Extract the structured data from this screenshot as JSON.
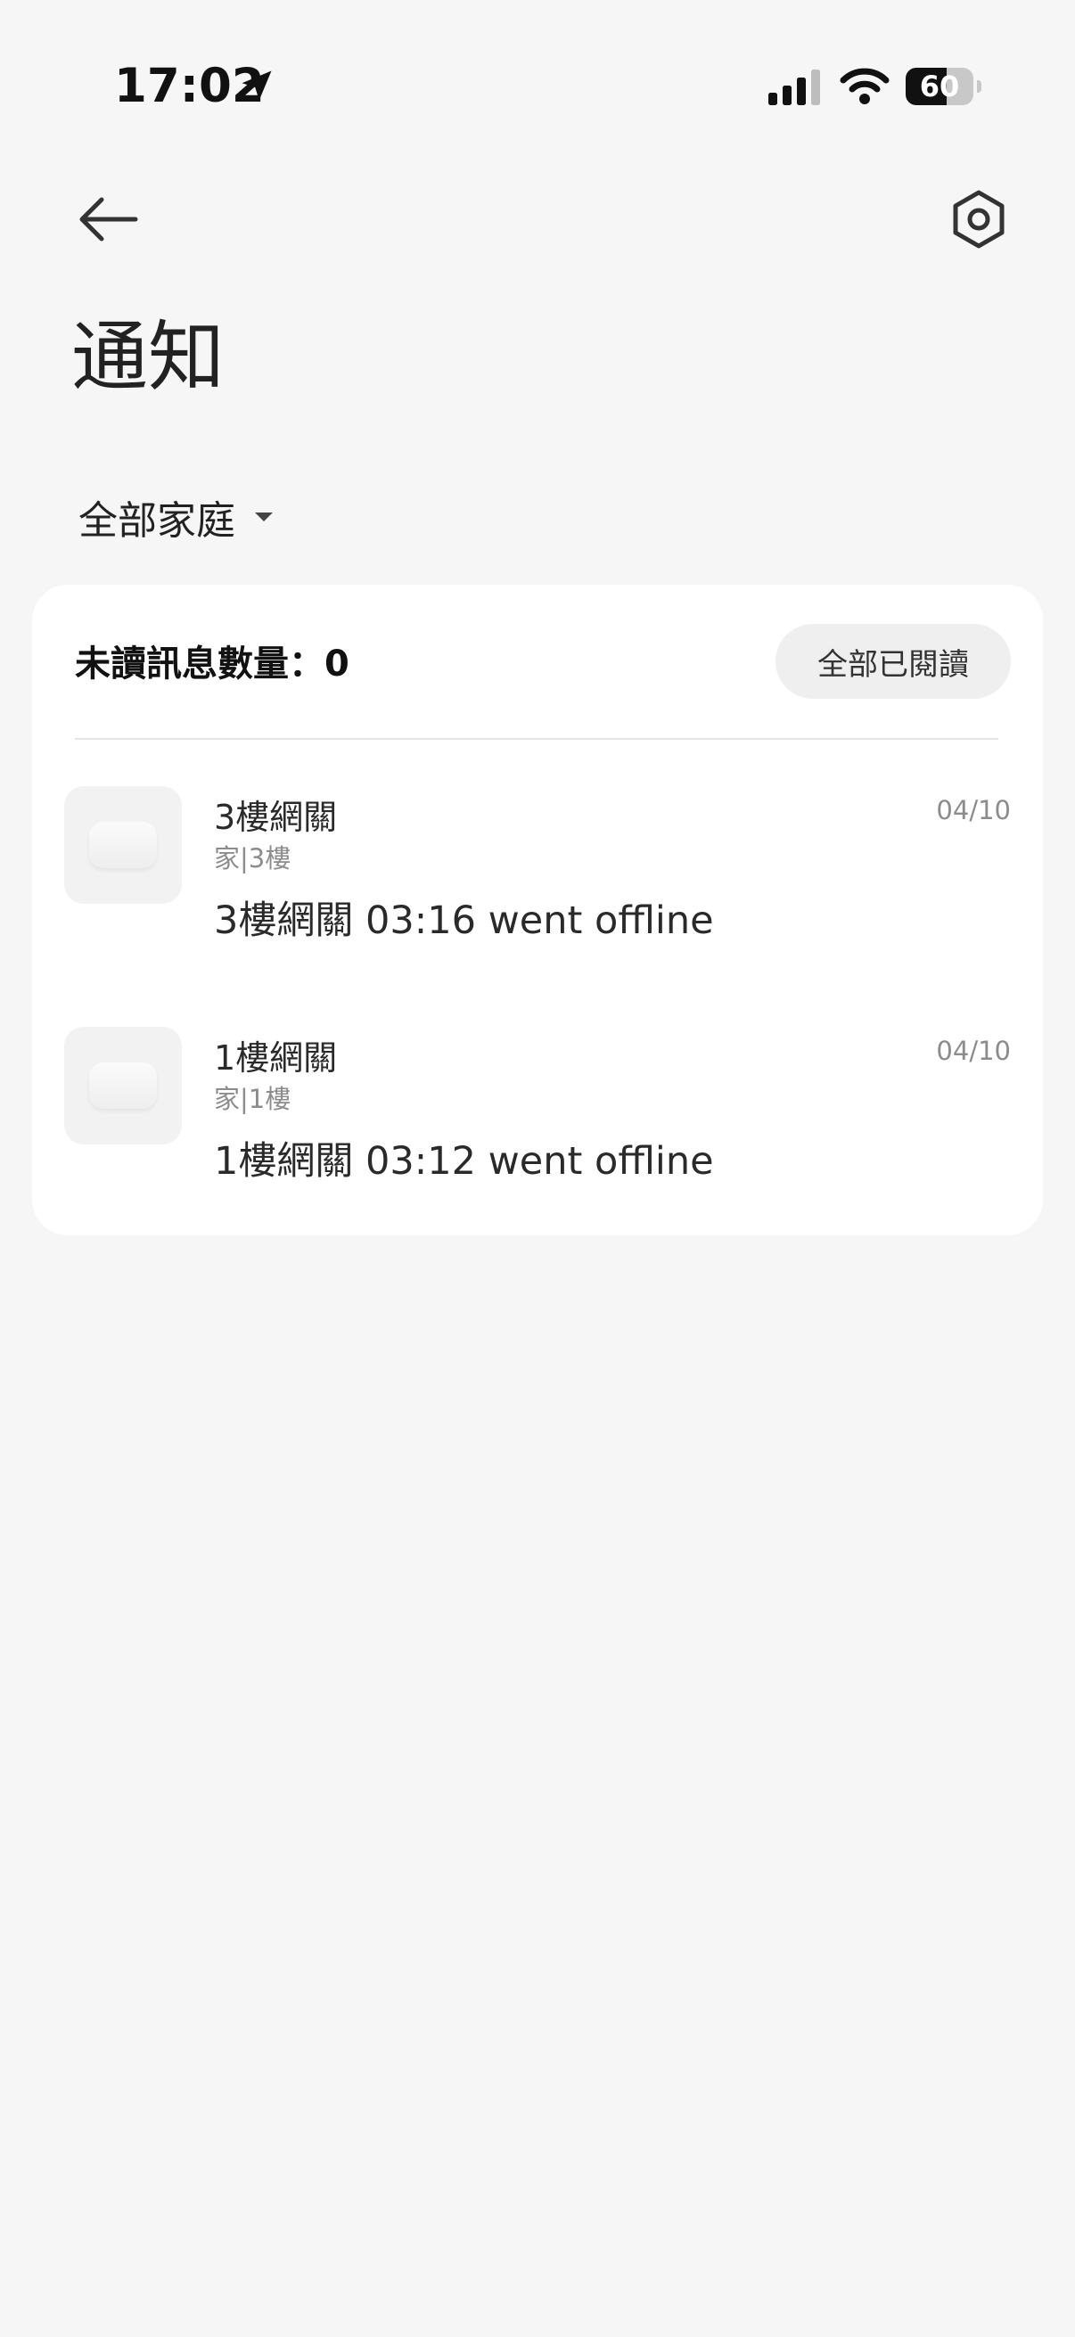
{
  "status_bar": {
    "time": "17:02",
    "battery_percent": "60",
    "battery_level": 0.6
  },
  "header": {
    "title": "通知",
    "home_filter": "全部家庭"
  },
  "card": {
    "unread_label": "未讀訊息數量：0",
    "mark_all_read": "全部已閱讀",
    "notifications": [
      {
        "name": "3樓網關",
        "location": "家|3樓",
        "date": "04/10",
        "message": "3樓網關 03:16 went offline"
      },
      {
        "name": "1樓網關",
        "location": "家|1樓",
        "date": "04/10",
        "message": "1樓網關 03:12 went offline"
      }
    ]
  },
  "icons": {
    "back": "arrow-left-icon",
    "settings": "hexagon-gear-icon",
    "dropdown": "caret-down-icon",
    "location": "location-arrow-icon",
    "signal": "cellular-signal-icon",
    "wifi": "wifi-icon"
  }
}
